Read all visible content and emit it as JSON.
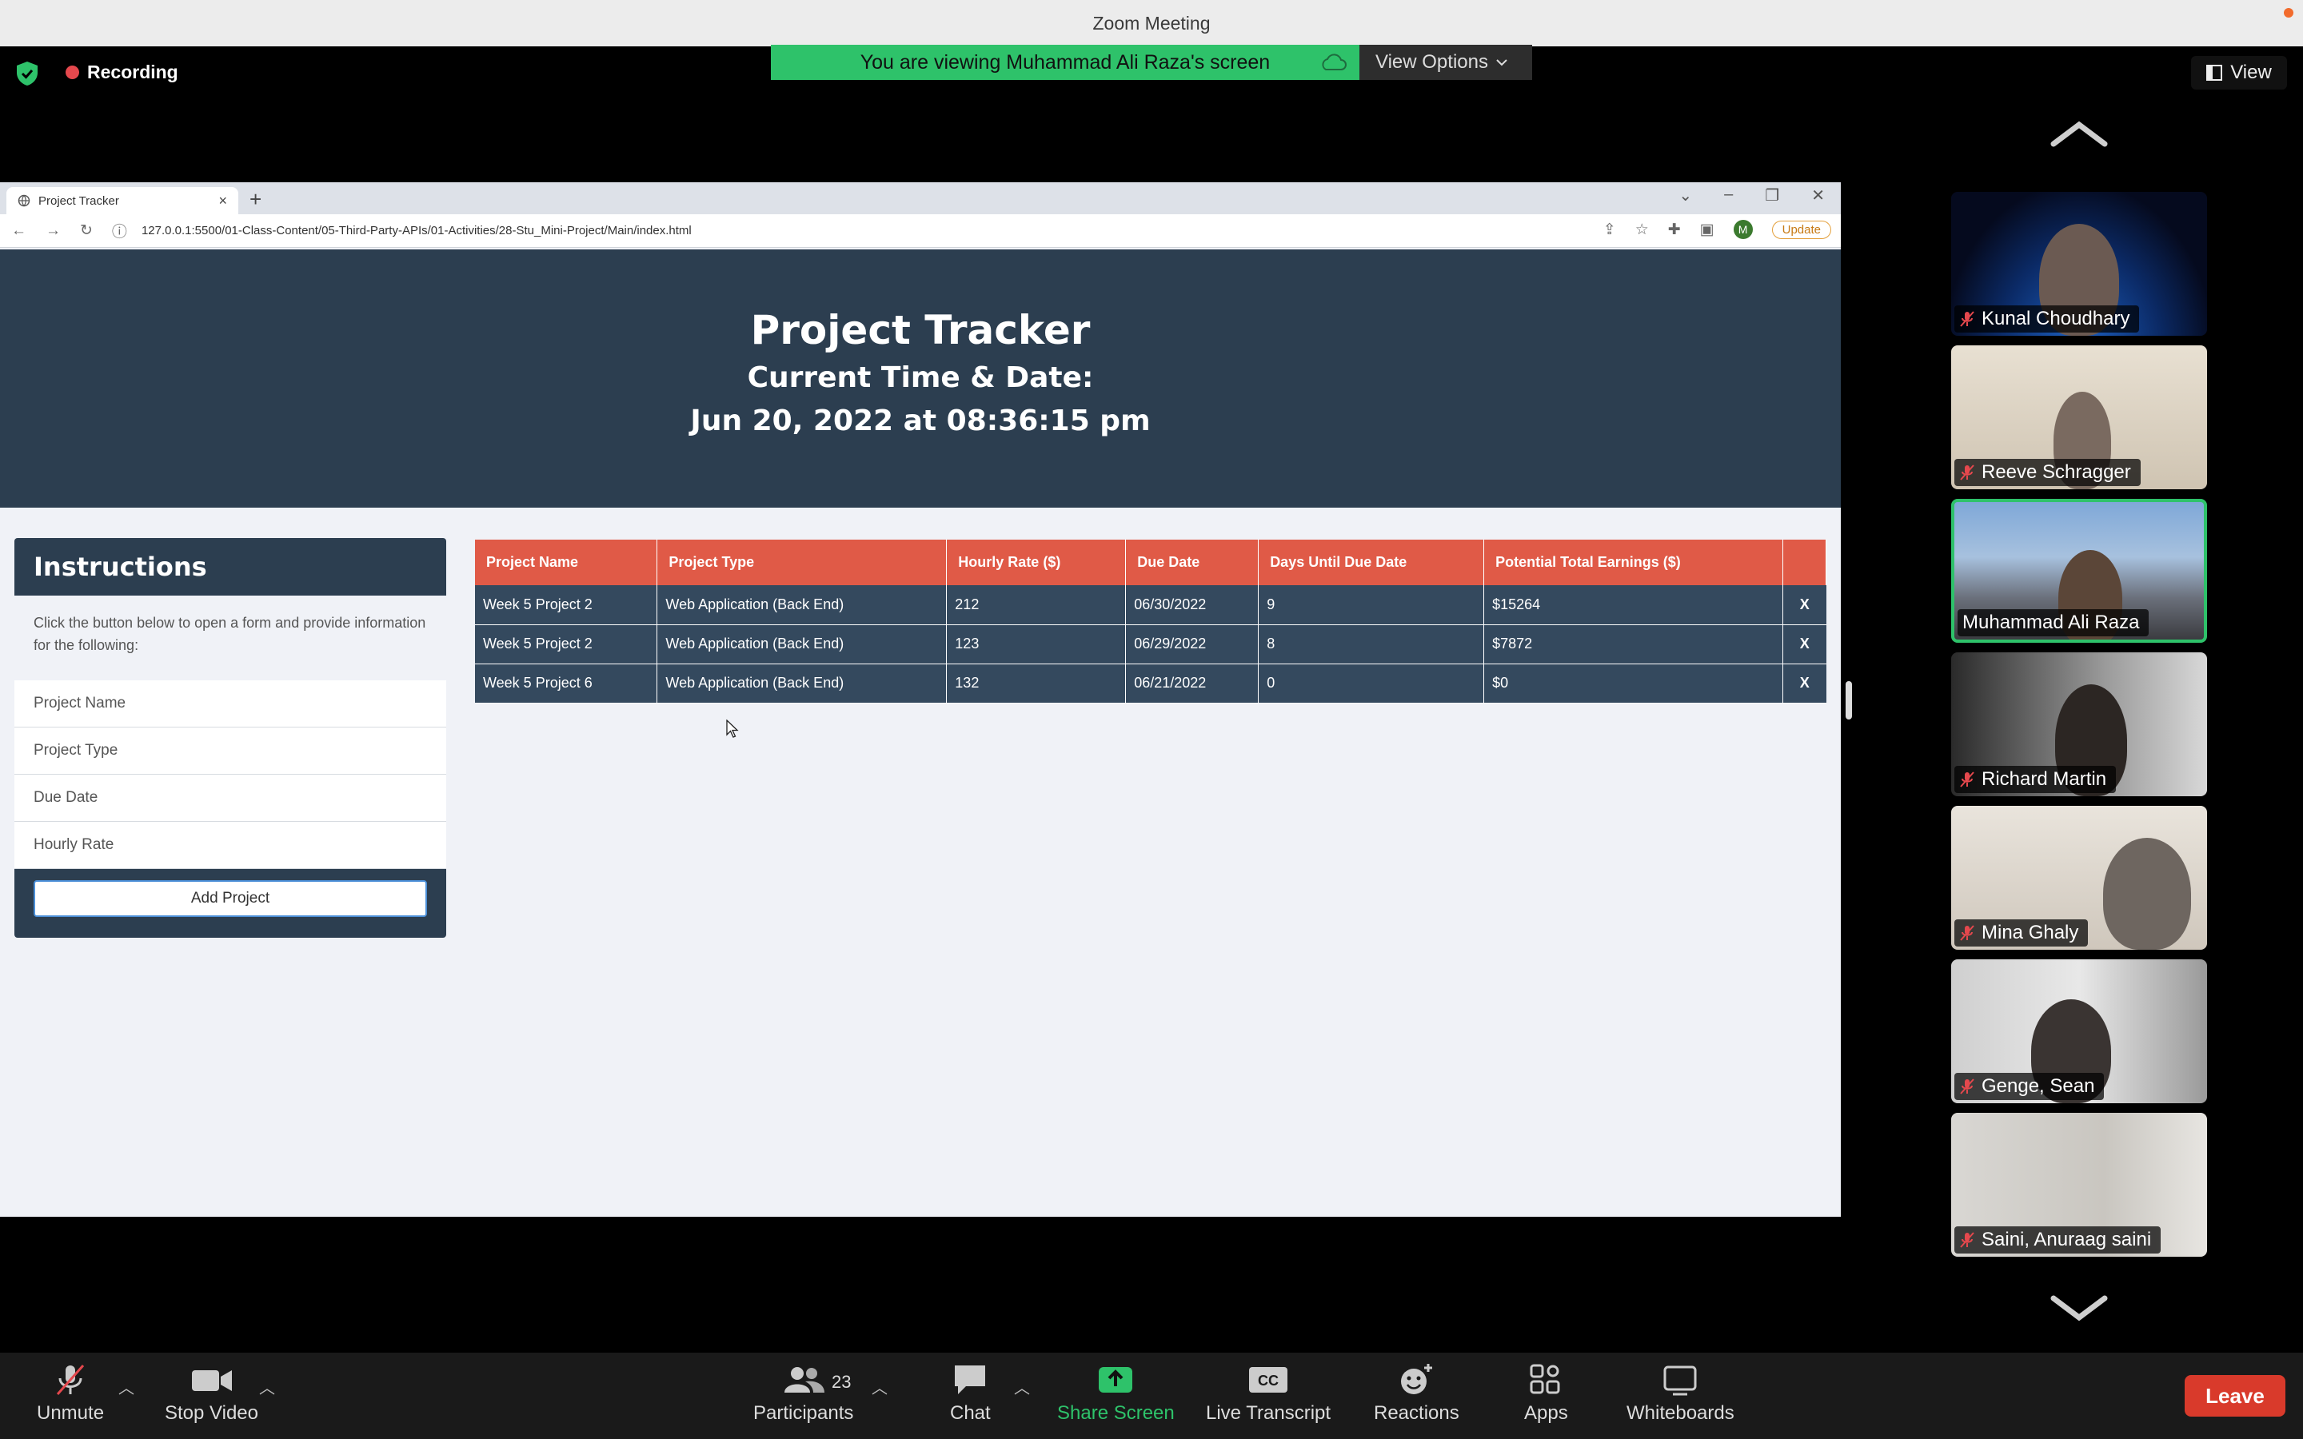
{
  "window": {
    "title": "Zoom Meeting"
  },
  "topbar": {
    "recording_label": "Recording",
    "viewing_banner": "You are viewing Muhammad Ali Raza's screen",
    "view_options_label": "View Options",
    "view_label": "View"
  },
  "browser": {
    "tab_title": "Project Tracker",
    "url": "127.0.0.1:5500/01-Class-Content/05-Third-Party-APIs/01-Activities/28-Stu_Mini-Project/Main/index.html",
    "profile_initial": "M",
    "update_label": "Update"
  },
  "page": {
    "title": "Project Tracker",
    "subtitle": "Current Time & Date:",
    "datetime": "Jun 20, 2022 at 08:36:15 pm",
    "instructions": {
      "title": "Instructions",
      "body": "Click the button below to open a form and provide information for the following:",
      "fields": [
        "Project Name",
        "Project Type",
        "Due Date",
        "Hourly Rate"
      ],
      "button": "Add Project"
    },
    "table": {
      "headers": [
        "Project Name",
        "Project Type",
        "Hourly Rate ($)",
        "Due Date",
        "Days Until Due Date",
        "Potential Total Earnings ($)",
        ""
      ],
      "rows": [
        [
          "Week 5 Project 2",
          "Web Application (Back End)",
          "212",
          "06/30/2022",
          "9",
          "$15264",
          "X"
        ],
        [
          "Week 5 Project 2",
          "Web Application (Back End)",
          "123",
          "06/29/2022",
          "8",
          "$7872",
          "X"
        ],
        [
          "Week 5 Project 6",
          "Web Application (Back End)",
          "132",
          "06/21/2022",
          "0",
          "$0",
          "X"
        ]
      ]
    }
  },
  "participants": [
    {
      "name": "Kunal Choudhary",
      "muted": true,
      "active": false
    },
    {
      "name": "Reeve Schragger",
      "muted": true,
      "active": false
    },
    {
      "name": "Muhammad Ali Raza",
      "muted": false,
      "active": true
    },
    {
      "name": "Richard Martin",
      "muted": true,
      "active": false
    },
    {
      "name": "Mina Ghaly",
      "muted": true,
      "active": false
    },
    {
      "name": "Genge, Sean",
      "muted": true,
      "active": false
    },
    {
      "name": "Saini, Anuraag saini",
      "muted": true,
      "active": false
    }
  ],
  "toolbar": {
    "unmute": "Unmute",
    "stop_video": "Stop Video",
    "participants": "Participants",
    "participant_count": "23",
    "chat": "Chat",
    "share_screen": "Share Screen",
    "live_transcript": "Live Transcript",
    "cc_badge": "CC",
    "reactions": "Reactions",
    "apps": "Apps",
    "whiteboards": "Whiteboards",
    "leave": "Leave"
  },
  "colors": {
    "accent_green": "#2ec26a",
    "header_navy": "#2c3e50",
    "table_header": "#e05a47",
    "leave_red": "#d93a2b"
  }
}
